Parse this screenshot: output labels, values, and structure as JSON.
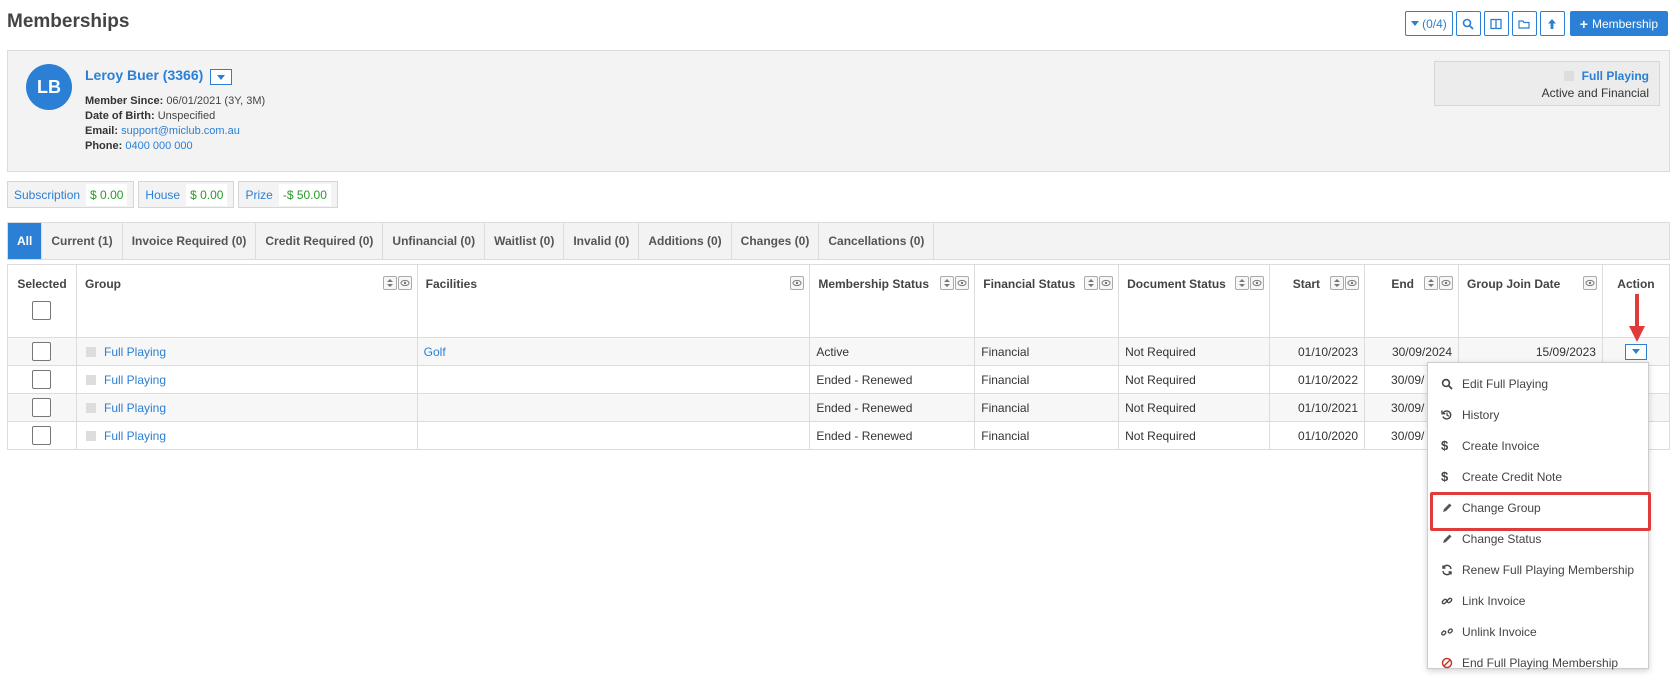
{
  "page": {
    "title": "Memberships"
  },
  "toolbar": {
    "filter_label": "(0/4)",
    "add_label": "Membership"
  },
  "member": {
    "initials": "LB",
    "name": "Leroy Buer (3366)",
    "since_label": "Member Since:",
    "since_value": "06/01/2021 (3Y, 3M)",
    "dob_label": "Date of Birth:",
    "dob_value": "Unspecified",
    "email_label": "Email:",
    "email_value": "support@miclub.com.au",
    "phone_label": "Phone:",
    "phone_value": "0400 000 000",
    "status_group": "Full Playing",
    "status_text": "Active and Financial"
  },
  "balances": [
    {
      "label": "Subscription",
      "value": "$ 0.00"
    },
    {
      "label": "House",
      "value": "$ 0.00"
    },
    {
      "label": "Prize",
      "value": "-$ 50.00"
    }
  ],
  "tabs": [
    "All",
    "Current (1)",
    "Invoice Required (0)",
    "Credit Required (0)",
    "Unfinancial (0)",
    "Waitlist (0)",
    "Invalid (0)",
    "Additions (0)",
    "Changes (0)",
    "Cancellations (0)"
  ],
  "columns": {
    "selected": "Selected",
    "group": "Group",
    "facilities": "Facilities",
    "membership_status": "Membership Status",
    "financial_status": "Financial Status",
    "document_status": "Document Status",
    "start": "Start",
    "end": "End",
    "group_join_date": "Group Join Date",
    "action": "Action"
  },
  "rows": [
    {
      "group": "Full Playing",
      "facilities": "Golf",
      "membership_status": "Active",
      "financial_status": "Financial",
      "document_status": "Not Required",
      "start": "01/10/2023",
      "end": "30/09/2024",
      "group_join_date": "15/09/2023"
    },
    {
      "group": "Full Playing",
      "facilities": "",
      "membership_status": "Ended - Renewed",
      "financial_status": "Financial",
      "document_status": "Not Required",
      "start": "01/10/2022",
      "end": "30/09/",
      "group_join_date": ""
    },
    {
      "group": "Full Playing",
      "facilities": "",
      "membership_status": "Ended - Renewed",
      "financial_status": "Financial",
      "document_status": "Not Required",
      "start": "01/10/2021",
      "end": "30/09/",
      "group_join_date": ""
    },
    {
      "group": "Full Playing",
      "facilities": "",
      "membership_status": "Ended - Renewed",
      "financial_status": "Financial",
      "document_status": "Not Required",
      "start": "01/10/2020",
      "end": "30/09/",
      "group_join_date": ""
    }
  ],
  "action_menu": [
    {
      "label": "Edit Full Playing",
      "icon": "search-icon"
    },
    {
      "label": "History",
      "icon": "history-icon"
    },
    {
      "label": "Create Invoice",
      "icon": "dollar-icon"
    },
    {
      "label": "Create Credit Note",
      "icon": "dollar-icon"
    },
    {
      "label": "Change Group",
      "icon": "pencil-icon"
    },
    {
      "label": "Change Status",
      "icon": "pencil-icon"
    },
    {
      "label": "Renew Full Playing Membership",
      "icon": "refresh-icon"
    },
    {
      "label": "Link Invoice",
      "icon": "link-icon"
    },
    {
      "label": "Unlink Invoice",
      "icon": "unlink-icon"
    },
    {
      "label": "End Full Playing Membership",
      "icon": "ban-icon"
    }
  ],
  "colors": {
    "accent": "#2b7fd4",
    "positive": "#2a9a2a",
    "ended": "#b43a3a",
    "highlight": "#e03b3b"
  }
}
